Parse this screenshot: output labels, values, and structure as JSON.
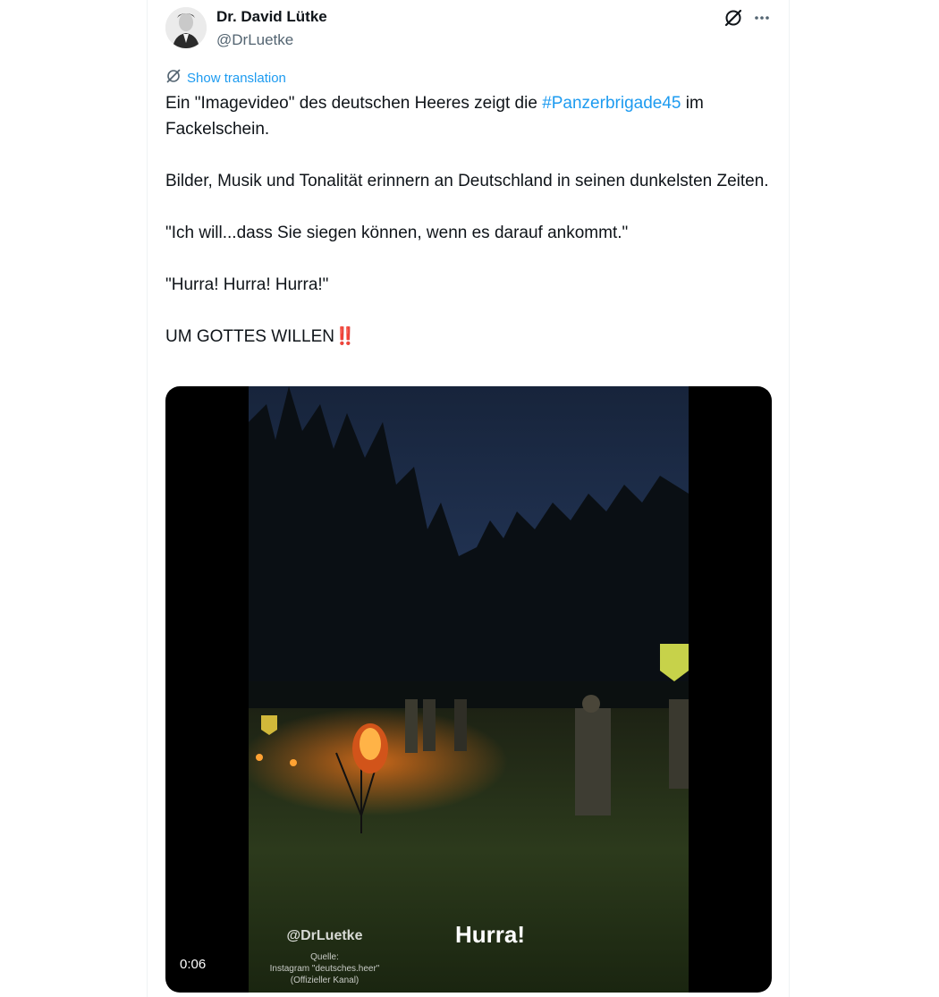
{
  "author": {
    "display_name": "Dr. David Lütke",
    "handle": "@DrLuetke",
    "avatar_icon": "profile-photo"
  },
  "header_icons": {
    "grok": "grok-slash-circle-icon",
    "more": "more-dots-icon"
  },
  "translation": {
    "label": "Show translation",
    "icon": "translate-icon"
  },
  "tweet": {
    "p1_before": "Ein \"Imagevideo\" des deutschen Heeres zeigt die ",
    "p1_hashtag": "#Panzerbrigade45",
    "p1_after": " im Fackelschein.",
    "p2": "Bilder, Musik und Tonalität erinnern an Deutschland in seinen dunkelsten Zeiten.",
    "p3": "\"Ich will...dass Sie siegen können, wenn es darauf ankommt.\"",
    "p4": "\"Hurra! Hurra! Hurra!\"",
    "p5": "UM GOTTES WILLEN",
    "p5_emoji": "‼️"
  },
  "media": {
    "time": "0:06",
    "watermark_handle": "@DrLuetke",
    "watermark_source_line1": "Quelle:",
    "watermark_source_line2": "Instagram \"deutsches.heer\"",
    "watermark_source_line3": "(Offizieller Kanal)",
    "caption": "Hurra!"
  },
  "colors": {
    "link": "#1d9bf0",
    "text": "#0f1419",
    "secondary": "#536471"
  }
}
